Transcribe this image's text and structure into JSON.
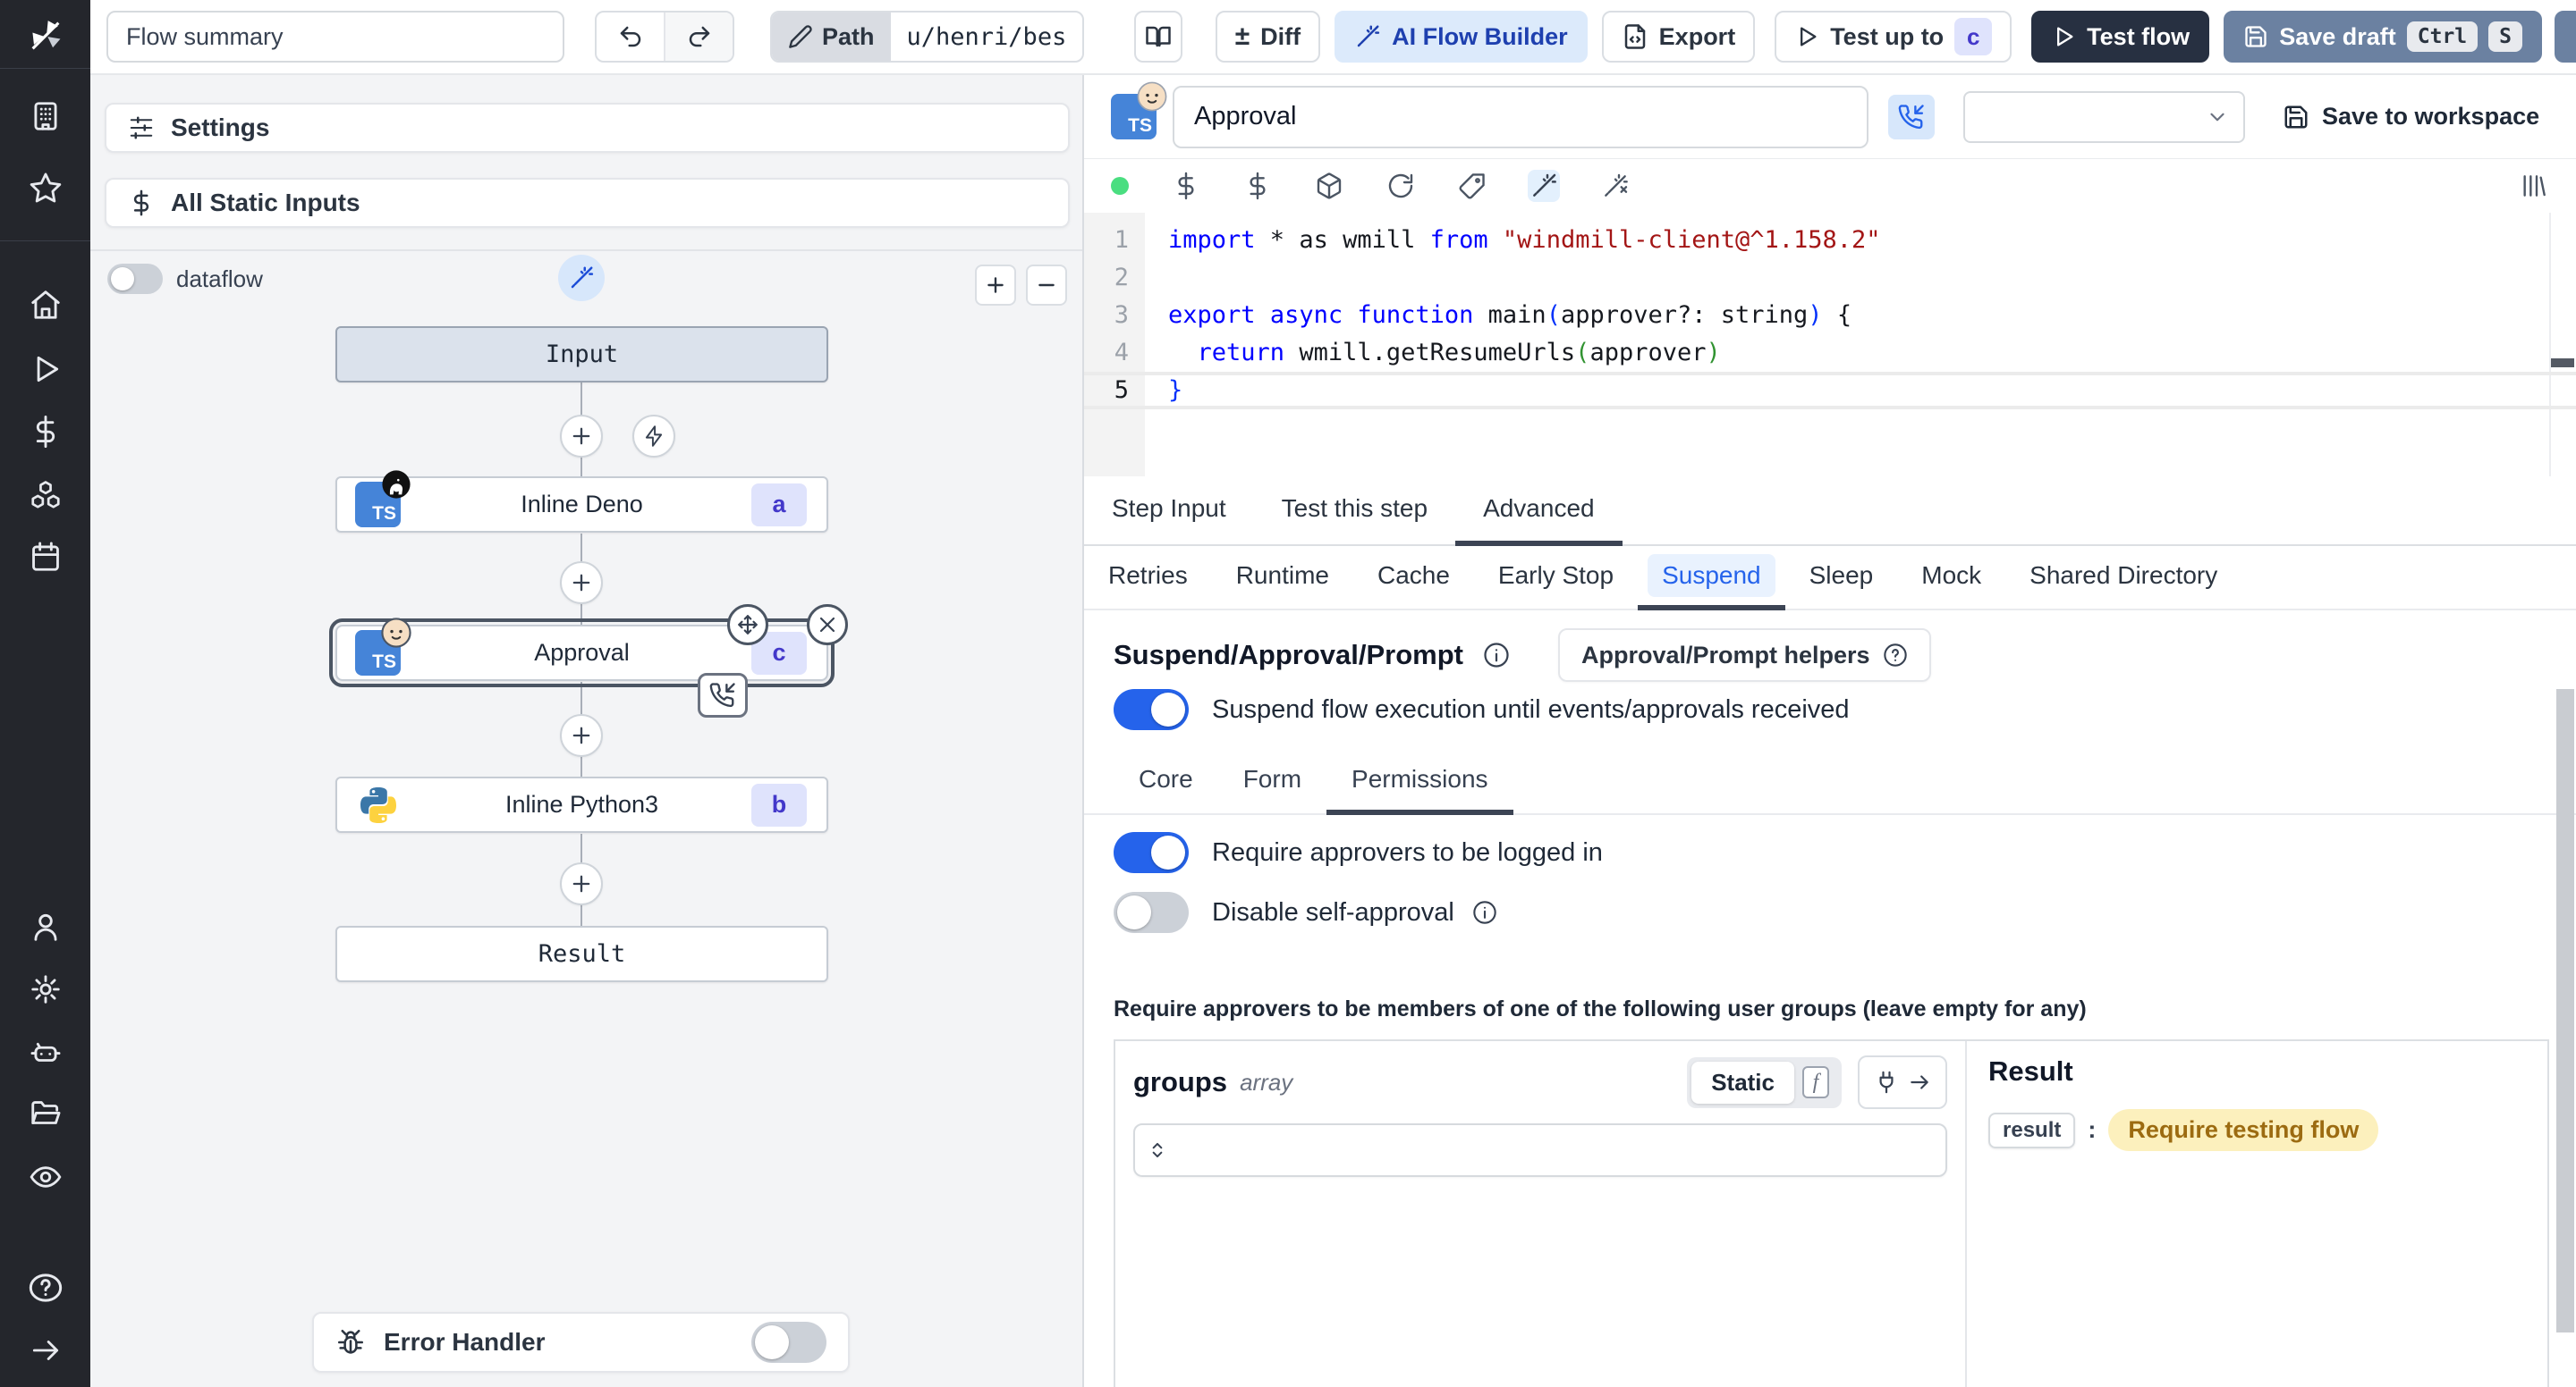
{
  "colors": {
    "accent_blue": "#2563eb",
    "toggle_on": "#2563eb",
    "badge_bg": "#dfe3fc",
    "badge_text": "#4338ca",
    "ai_button_bg": "#dceafb",
    "test_flow_bg": "#273041",
    "save_draft_bg": "#6b81a1",
    "result_highlight_bg": "#fcf0bd",
    "result_highlight_text": "#9c6b11",
    "selected_node_ring": "#4b5563"
  },
  "topbar": {
    "flow_summary_value": "Flow summary",
    "path_label": "Path",
    "path_value": "u/henri/bes",
    "diff_icon": "±",
    "diff_label": "Diff",
    "ai_flow_builder_label": "AI Flow Builder",
    "export_label": "Export",
    "test_up_to_label": "Test up to",
    "test_up_to_badge": "c",
    "test_flow_label": "Test flow",
    "save_draft_label": "Save draft",
    "save_draft_kbd_ctrl": "Ctrl",
    "save_draft_kbd_s": "S"
  },
  "flow_panel": {
    "settings_label": "Settings",
    "all_static_inputs_label": "All Static Inputs",
    "dataflow_label": "dataflow",
    "nodes": {
      "input_label": "Input",
      "deno": {
        "title": "Inline Deno",
        "badge": "a"
      },
      "approval": {
        "title": "Approval",
        "badge": "c"
      },
      "python": {
        "title": "Inline Python3",
        "badge": "b"
      },
      "result_label": "Result"
    },
    "error_handler_label": "Error Handler"
  },
  "step_header": {
    "name_value": "Approval",
    "save_to_workspace_label": "Save to workspace"
  },
  "code": {
    "lines": [
      {
        "n": "1",
        "seg": [
          {
            "c": "k",
            "t": "import"
          },
          {
            "c": "p",
            "t": " * as wmill "
          },
          {
            "c": "k",
            "t": "from"
          },
          {
            "c": "p",
            "t": " "
          },
          {
            "c": "s",
            "t": "\"windmill-client@^1.158.2\""
          }
        ]
      },
      {
        "n": "2",
        "seg": []
      },
      {
        "n": "3",
        "seg": [
          {
            "c": "k",
            "t": "export"
          },
          {
            "c": "p",
            "t": " "
          },
          {
            "c": "k",
            "t": "async"
          },
          {
            "c": "p",
            "t": " "
          },
          {
            "c": "k",
            "t": "function"
          },
          {
            "c": "p",
            "t": " main"
          },
          {
            "c": "b1",
            "t": "("
          },
          {
            "c": "p",
            "t": "approver?: string"
          },
          {
            "c": "b1",
            "t": ")"
          },
          {
            "c": "p",
            "t": " {"
          }
        ]
      },
      {
        "n": "4",
        "seg": [
          {
            "c": "p",
            "t": "  "
          },
          {
            "c": "k",
            "t": "return"
          },
          {
            "c": "p",
            "t": " wmill.getResumeUrls"
          },
          {
            "c": "b2",
            "t": "("
          },
          {
            "c": "p",
            "t": "approver"
          },
          {
            "c": "b2",
            "t": ")"
          }
        ]
      },
      {
        "n": "5",
        "active": true,
        "seg": [
          {
            "c": "b1",
            "t": "}"
          }
        ]
      }
    ]
  },
  "tabs": {
    "primary": [
      "Step Input",
      "Test this step",
      "Advanced"
    ],
    "primary_active": "Advanced",
    "advanced": [
      "Retries",
      "Runtime",
      "Cache",
      "Early Stop",
      "Suspend",
      "Sleep",
      "Mock",
      "Shared Directory"
    ],
    "advanced_active": "Suspend"
  },
  "suspend": {
    "title": "Suspend/Approval/Prompt",
    "helpers_button_label": "Approval/Prompt helpers",
    "suspend_toggle_label": "Suspend flow execution until events/approvals received",
    "subtabs": [
      "Core",
      "Form",
      "Permissions"
    ],
    "subtab_active": "Permissions",
    "require_login_label": "Require approvers to be logged in",
    "disable_self_approval_label": "Disable self-approval",
    "groups_note": "Require approvers to be members of one of the following user groups (leave empty for any)"
  },
  "groups_editor": {
    "name": "groups",
    "type_label": "array",
    "static_label": "Static"
  },
  "result_panel": {
    "title": "Result",
    "key": "result",
    "value": "Require testing flow"
  }
}
